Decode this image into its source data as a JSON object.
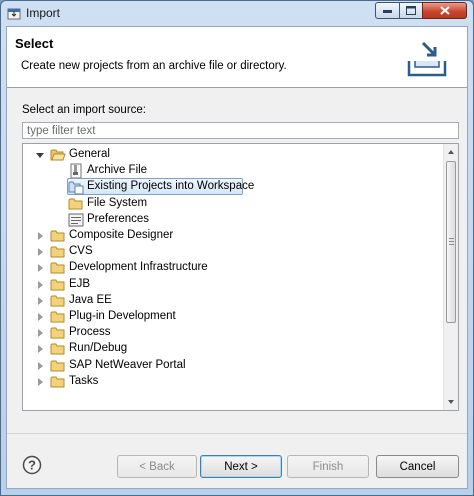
{
  "window": {
    "title": "Import"
  },
  "header": {
    "title": "Select",
    "description": "Create new projects from an archive file or directory."
  },
  "source": {
    "label": "Select an import source:",
    "filter_placeholder": "type filter text",
    "filter_value": ""
  },
  "tree": {
    "items": [
      {
        "label": "General",
        "level": 0,
        "expanded": true,
        "icon": "folder-open-icon"
      },
      {
        "label": "Archive File",
        "level": 1,
        "icon": "archive-file-icon"
      },
      {
        "label": "Existing Projects into Workspace",
        "level": 1,
        "icon": "projects-icon",
        "selected": true
      },
      {
        "label": "File System",
        "level": 1,
        "icon": "folder-icon"
      },
      {
        "label": "Preferences",
        "level": 1,
        "icon": "preferences-icon"
      },
      {
        "label": "Composite Designer",
        "level": 0,
        "expanded": false,
        "icon": "folder-icon"
      },
      {
        "label": "CVS",
        "level": 0,
        "expanded": false,
        "icon": "folder-icon"
      },
      {
        "label": "Development Infrastructure",
        "level": 0,
        "expanded": false,
        "icon": "folder-icon"
      },
      {
        "label": "EJB",
        "level": 0,
        "expanded": false,
        "icon": "folder-icon"
      },
      {
        "label": "Java EE",
        "level": 0,
        "expanded": false,
        "icon": "folder-icon"
      },
      {
        "label": "Plug-in Development",
        "level": 0,
        "expanded": false,
        "icon": "folder-icon"
      },
      {
        "label": "Process",
        "level": 0,
        "expanded": false,
        "icon": "folder-icon"
      },
      {
        "label": "Run/Debug",
        "level": 0,
        "expanded": false,
        "icon": "folder-icon"
      },
      {
        "label": "SAP NetWeaver Portal",
        "level": 0,
        "expanded": false,
        "icon": "folder-icon"
      },
      {
        "label": "Tasks",
        "level": 0,
        "expanded": false,
        "icon": "folder-icon"
      }
    ]
  },
  "buttons": {
    "back": "< Back",
    "next": "Next >",
    "finish": "Finish",
    "cancel": "Cancel"
  },
  "colors": {
    "titlebar": "#b9d0ea",
    "selection": "#d6e7f9",
    "folder": "#e8c45a"
  }
}
